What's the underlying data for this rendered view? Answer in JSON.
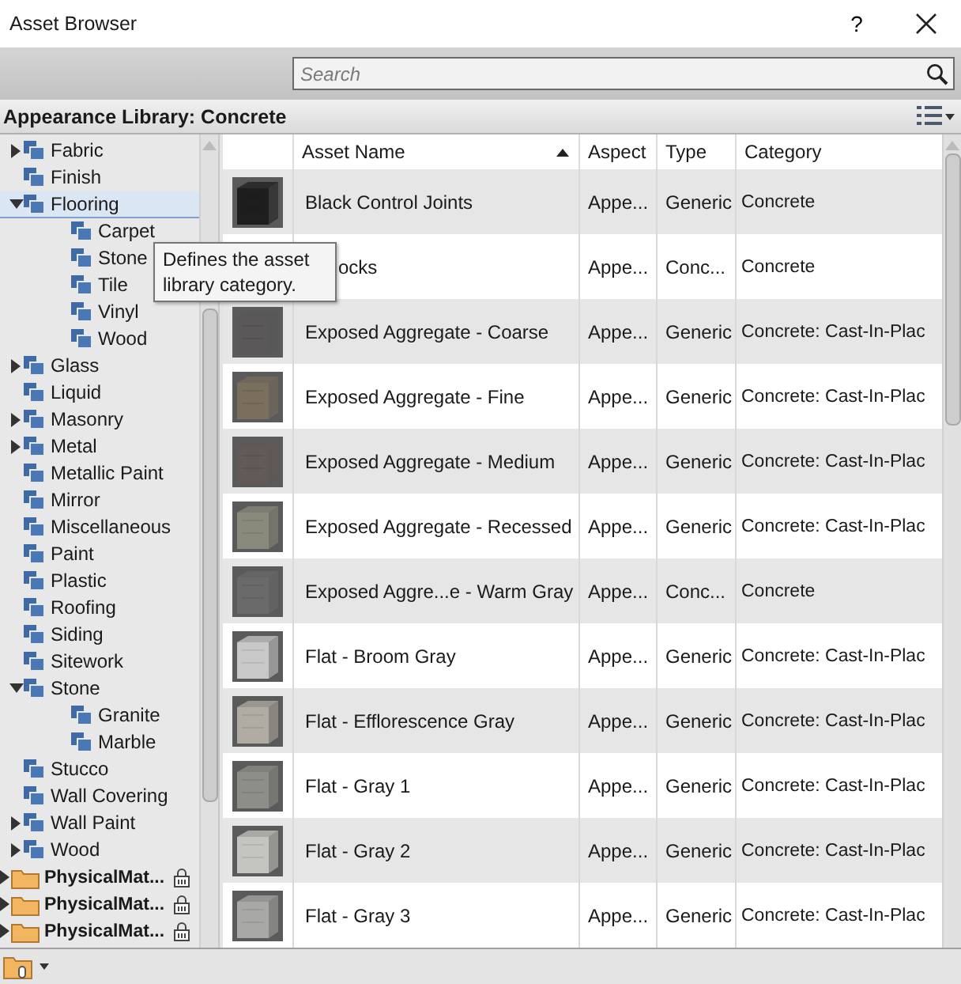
{
  "window": {
    "title": "Asset Browser",
    "help": "?"
  },
  "search": {
    "placeholder": "Search"
  },
  "library_header": "Appearance Library: Concrete",
  "tree": [
    {
      "label": "Fabric",
      "expanded": false,
      "selected": false
    },
    {
      "label": "Finish",
      "selected": false
    },
    {
      "label": "Flooring",
      "expanded": true,
      "selected": true,
      "children": [
        {
          "label": "Carpet",
          "selected": false
        },
        {
          "label": "Stone",
          "selected": false
        },
        {
          "label": "Tile",
          "selected": false
        },
        {
          "label": "Vinyl",
          "selected": false
        },
        {
          "label": "Wood",
          "selected": false
        }
      ]
    },
    {
      "label": "Glass",
      "expanded": false,
      "selected": false
    },
    {
      "label": "Liquid",
      "selected": false
    },
    {
      "label": "Masonry",
      "expanded": false,
      "selected": false
    },
    {
      "label": "Metal",
      "expanded": false,
      "selected": false
    },
    {
      "label": "Metallic Paint",
      "selected": false
    },
    {
      "label": "Mirror",
      "selected": false
    },
    {
      "label": "Miscellaneous",
      "selected": false
    },
    {
      "label": "Paint",
      "selected": false
    },
    {
      "label": "Plastic",
      "selected": false
    },
    {
      "label": "Roofing",
      "selected": false
    },
    {
      "label": "Siding",
      "selected": false
    },
    {
      "label": "Sitework",
      "selected": false
    },
    {
      "label": "Stone",
      "expanded": true,
      "selected": false,
      "children": [
        {
          "label": "Granite",
          "selected": false
        },
        {
          "label": "Marble",
          "selected": false
        }
      ]
    },
    {
      "label": "Stucco",
      "selected": false
    },
    {
      "label": "Wall Covering",
      "selected": false
    },
    {
      "label": "Wall Paint",
      "expanded": false,
      "selected": false
    },
    {
      "label": "Wood",
      "expanded": false,
      "selected": false
    }
  ],
  "libraries": [
    {
      "label": "PhysicalMat...",
      "locked": true,
      "expanded": false
    },
    {
      "label": "PhysicalMat...",
      "locked": true,
      "expanded": false
    },
    {
      "label": "PhysicalMat...",
      "locked": true,
      "expanded": false
    }
  ],
  "tooltip": "Defines the asset library category.",
  "table": {
    "columns": [
      {
        "label": "Asset Name",
        "sorted": true
      },
      {
        "label": "Aspect",
        "sorted": false
      },
      {
        "label": "Type",
        "sorted": false
      },
      {
        "label": "Category",
        "sorted": false
      }
    ],
    "rows": [
      {
        "name": "Black Control Joints",
        "aspect": "Appe...",
        "type": "Generic",
        "category": "Concrete",
        "color": "#1e1e1e"
      },
      {
        "name": "ocks",
        "aspect": "Appe...",
        "type": "Conc...",
        "category": "Concrete",
        "partly_hidden": true
      },
      {
        "name": "Exposed Aggregate - Coarse",
        "aspect": "Appe...",
        "type": "Generic",
        "category": "Concrete: Cast-In-Plac",
        "color": "#5a5858"
      },
      {
        "name": "Exposed Aggregate - Fine",
        "aspect": "Appe...",
        "type": "Generic",
        "category": "Concrete: Cast-In-Plac",
        "color": "#7a6e5c"
      },
      {
        "name": "Exposed Aggregate - Medium",
        "aspect": "Appe...",
        "type": "Generic",
        "category": "Concrete: Cast-In-Plac",
        "color": "#625a56"
      },
      {
        "name": "Exposed Aggregate - Recessed",
        "aspect": "Appe...",
        "type": "Generic",
        "category": "Concrete: Cast-In-Plac",
        "color": "#8a8a7c"
      },
      {
        "name": "Exposed Aggre...e - Warm Gray",
        "aspect": "Appe...",
        "type": "Conc...",
        "category": "Concrete",
        "color": "#6a6a6a"
      },
      {
        "name": "Flat - Broom Gray",
        "aspect": "Appe...",
        "type": "Generic",
        "category": "Concrete: Cast-In-Plac",
        "color": "#c8c8c8"
      },
      {
        "name": "Flat - Efflorescence Gray",
        "aspect": "Appe...",
        "type": "Generic",
        "category": "Concrete: Cast-In-Plac",
        "color": "#b0aca4"
      },
      {
        "name": "Flat - Gray 1",
        "aspect": "Appe...",
        "type": "Generic",
        "category": "Concrete: Cast-In-Plac",
        "color": "#8e8e88"
      },
      {
        "name": "Flat - Gray 2",
        "aspect": "Appe...",
        "type": "Generic",
        "category": "Concrete: Cast-In-Plac",
        "color": "#c4c4c0"
      },
      {
        "name": "Flat - Gray 3",
        "aspect": "Appe...",
        "type": "Generic",
        "category": "Concrete: Cast-In-Plac",
        "color": "#a8a8a6"
      }
    ]
  }
}
